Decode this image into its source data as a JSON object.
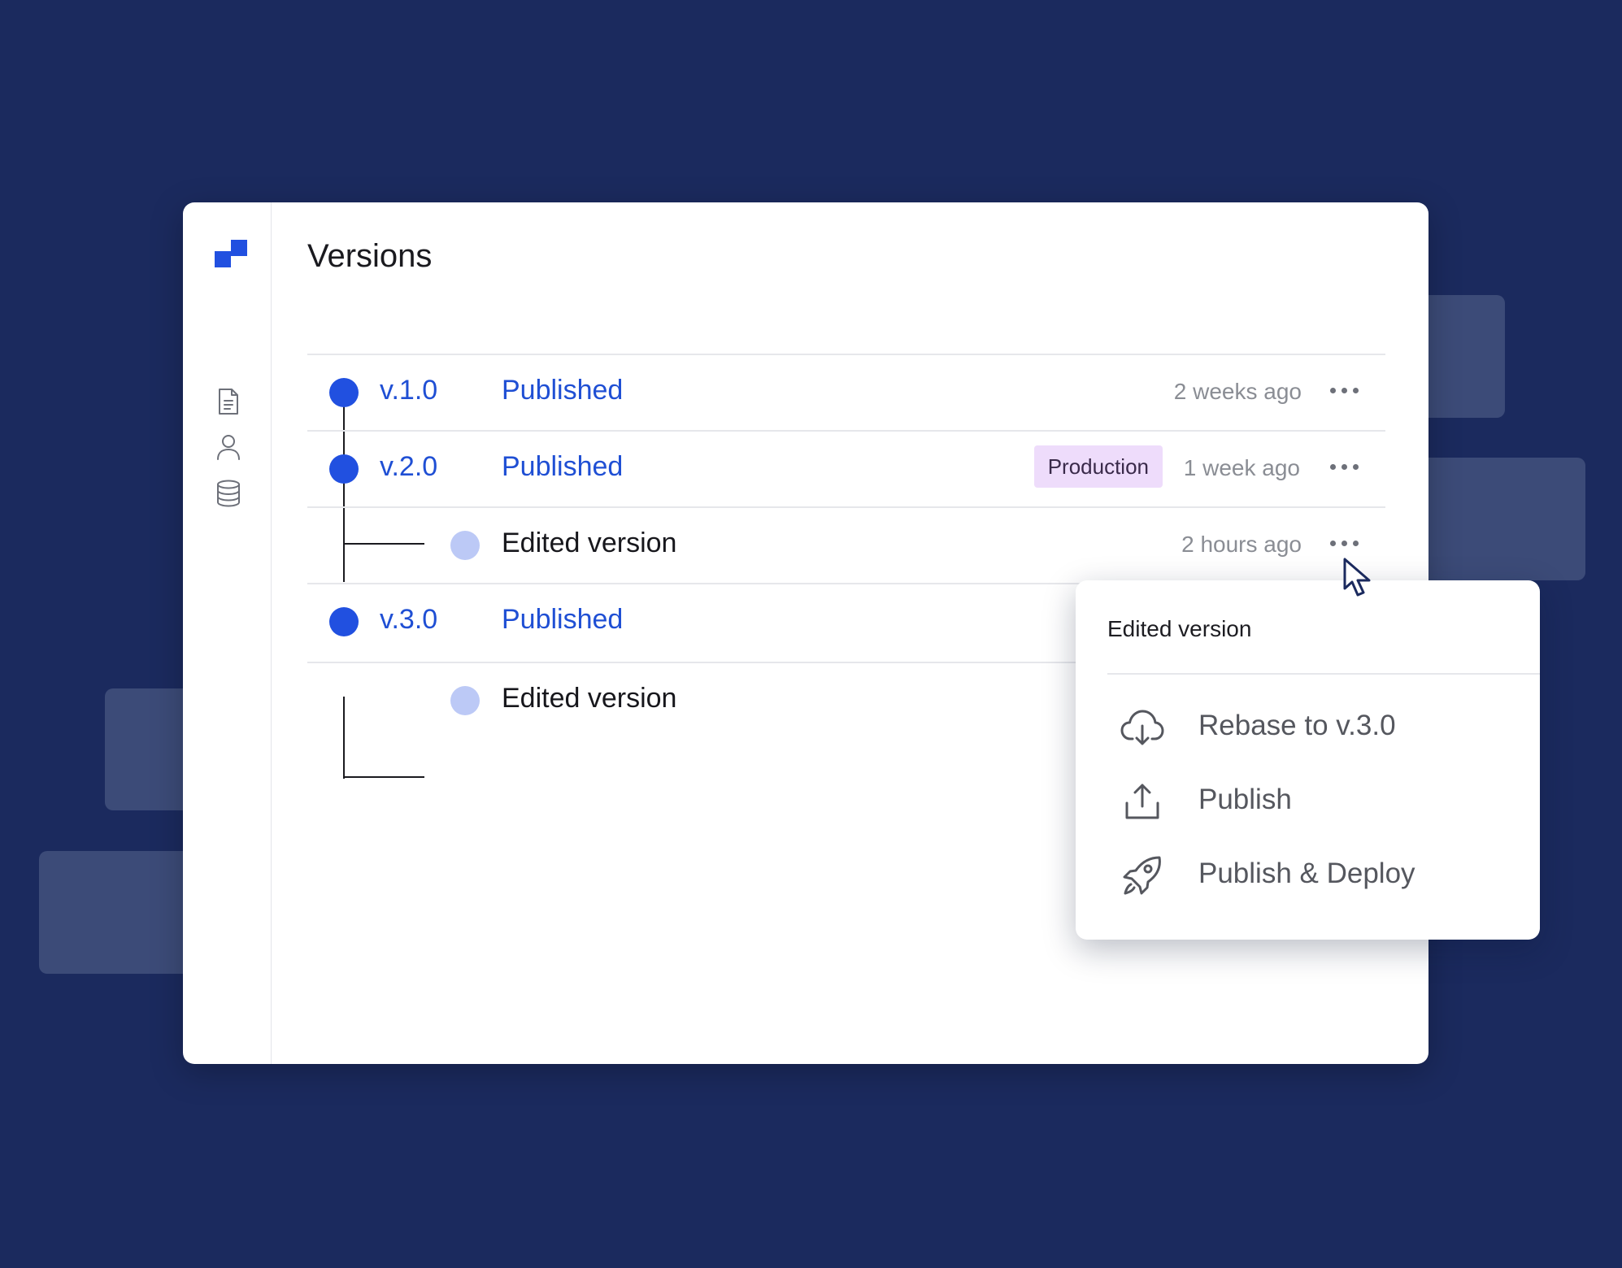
{
  "page": {
    "title": "Versions"
  },
  "sidebar": {
    "items": [
      {
        "icon": "document-icon"
      },
      {
        "icon": "user-icon"
      },
      {
        "icon": "database-icon"
      }
    ]
  },
  "versions": [
    {
      "version": "v.1.0",
      "status": "Published",
      "time": "2 weeks ago"
    },
    {
      "version": "v.2.0",
      "status": "Published",
      "badge": "Production",
      "time": "1 week ago"
    },
    {
      "label": "Edited version",
      "time": "2 hours ago"
    },
    {
      "version": "v.3.0",
      "status": "Published"
    },
    {
      "label": "Edited version"
    }
  ],
  "menu": {
    "title": "Edited version",
    "items": [
      {
        "label": "Rebase to v.3.0",
        "icon": "cloud-download-icon"
      },
      {
        "label": "Publish",
        "icon": "upload-icon"
      },
      {
        "label": "Publish & Deploy",
        "icon": "rocket-icon"
      }
    ]
  },
  "colors": {
    "background": "#1b2a5e",
    "accent": "#2150e0",
    "sub_dot": "#bcc9f6",
    "badge_bg": "#eedcfb"
  }
}
